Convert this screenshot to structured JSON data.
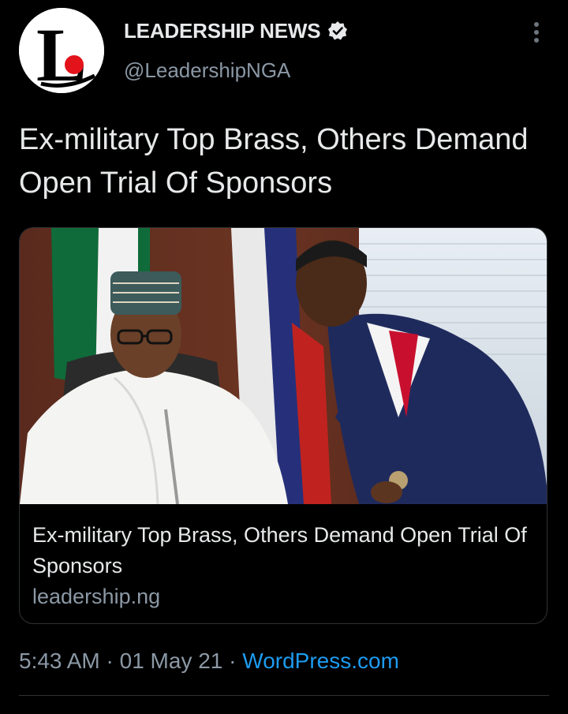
{
  "account": {
    "display_name": "LEADERSHIP NEWS",
    "handle": "@LeadershipNGA",
    "verified": true,
    "avatar_icon": "leadership-logo",
    "avatar_letter": "L"
  },
  "tweet": {
    "text": "Ex-military Top Brass, Others Demand Open Trial Of Sponsors"
  },
  "link_card": {
    "image_description_icon": "news-photo",
    "title": "Ex-military Top Brass, Others Demand Open Trial Of Sponsors",
    "domain": "leadership.ng"
  },
  "footer": {
    "time": "5:43 AM",
    "separator": "·",
    "date": "01 May 21",
    "source": "WordPress.com"
  },
  "colors": {
    "background": "#000000",
    "text_primary": "#e7e9ea",
    "text_secondary": "#8b98a5",
    "link": "#1d9bf0",
    "border": "#2f3336",
    "logo_red": "#e3131b"
  }
}
